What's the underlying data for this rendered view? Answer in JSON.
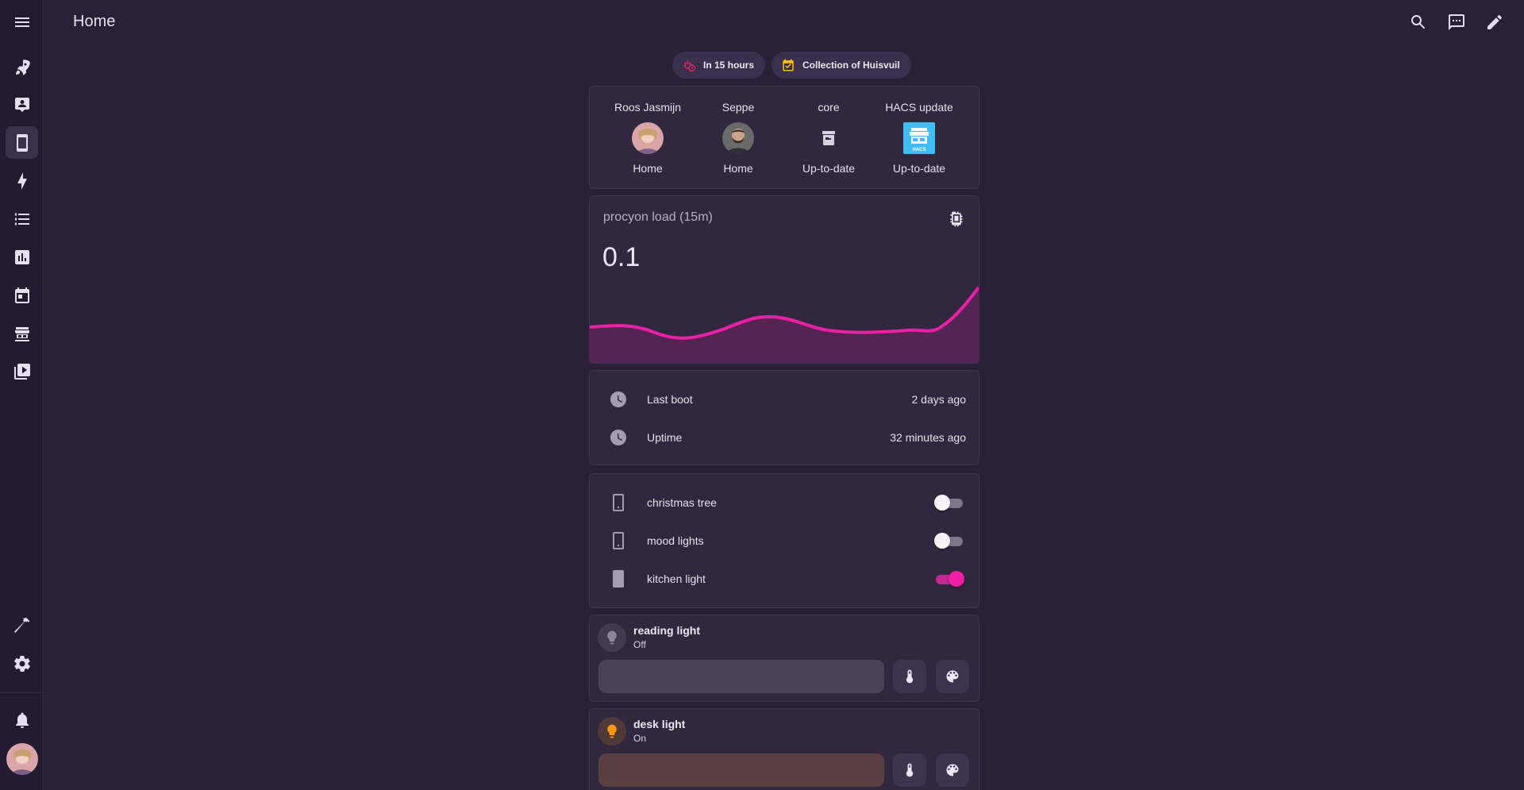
{
  "header": {
    "title": "Home"
  },
  "chips": [
    {
      "label": "In 15 hours",
      "icon": "sun-clock-icon",
      "color": "#e91e63"
    },
    {
      "label": "Collection of Huisvuil",
      "icon": "calendar-check-icon",
      "color": "#ffc107"
    }
  ],
  "glance": {
    "items": [
      {
        "name": "Roos Jasmijn",
        "state": "Home",
        "icon": "person-avatar"
      },
      {
        "name": "Seppe",
        "state": "Home",
        "icon": "person-avatar"
      },
      {
        "name": "core",
        "state": "Up-to-date",
        "icon": "package-icon"
      },
      {
        "name": "HACS update",
        "state": "Up-to-date",
        "icon": "hacs-logo"
      }
    ]
  },
  "sensor": {
    "name": "procyon load (15m)",
    "value": "0.1",
    "icon": "cpu-chip-icon",
    "color": "#f11fa6"
  },
  "system": {
    "rows": [
      {
        "label": "Last boot",
        "value": "2 days ago",
        "icon": "clock-icon"
      },
      {
        "label": "Uptime",
        "value": "32 minutes ago",
        "icon": "clock-icon"
      }
    ]
  },
  "switches": {
    "rows": [
      {
        "label": "christmas tree",
        "on": false,
        "icon": "light-switch-icon"
      },
      {
        "label": "mood lights",
        "on": false,
        "icon": "light-switch-icon"
      },
      {
        "label": "kitchen light",
        "on": true,
        "icon": "light-switch-icon"
      }
    ]
  },
  "tiles": [
    {
      "name": "reading light",
      "state": "Off",
      "icon": "lightbulb-icon",
      "color": "#8f869e",
      "slider_color": "#4a4259"
    },
    {
      "name": "desk light",
      "state": "On",
      "icon": "lightbulb-icon",
      "color": "#ff9800",
      "slider_color": "#5a3f40"
    }
  ],
  "accent_color": "#f11fa6"
}
